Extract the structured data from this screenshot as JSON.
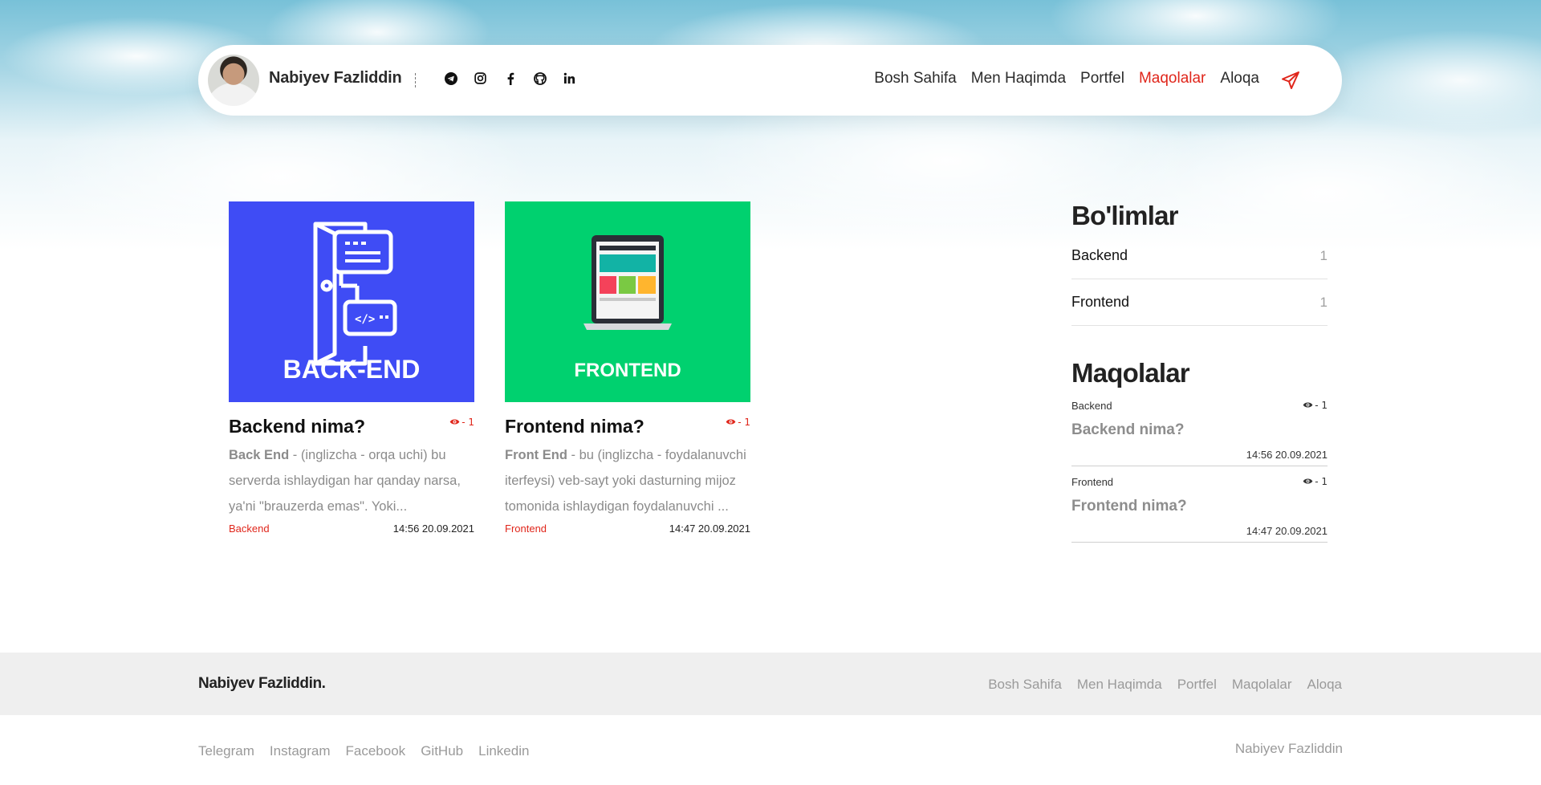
{
  "header": {
    "name": "Nabiyev Fazliddin",
    "socials": [
      {
        "icon": "telegram-icon",
        "glyph": "✈"
      },
      {
        "icon": "instagram-icon",
        "glyph": "◎"
      },
      {
        "icon": "facebook-icon",
        "glyph": "f"
      },
      {
        "icon": "github-icon",
        "glyph": "◉"
      },
      {
        "icon": "linkedin-icon",
        "glyph": "in"
      }
    ],
    "nav": [
      "Bosh Sahifa",
      "Men Haqimda",
      "Portfel",
      "Maqolalar",
      "Aloqa"
    ],
    "active_nav": "Maqolalar",
    "send_icon": "send-icon",
    "accent_color": "#e0261b"
  },
  "articles": [
    {
      "image": {
        "label": "BACK-END",
        "bg": "#3f4cf5",
        "icon": "backend-door-icon"
      },
      "title": "Backend nima?",
      "views": "- 1",
      "lead": "Back End",
      "excerpt": " - (inglizcha - orqa uchi) bu serverda ishlaydigan har qanday narsa, ya'ni \"brauzerda emas\". Yoki...",
      "category": "Backend",
      "date": "14:56 20.09.2021"
    },
    {
      "image": {
        "label": "FRONTEND",
        "bg": "#00d16f",
        "icon": "laptop-icon"
      },
      "title": "Frontend nima?",
      "views": "- 1",
      "lead": "Front End",
      "excerpt": " - bu (inglizcha - foydalanuvchi iterfeysi) veb-sayt yoki dasturning mijoz tomonida ishlaydigan foydalanuvchi ...",
      "category": "Frontend",
      "date": "14:47 20.09.2021"
    }
  ],
  "sidebar": {
    "categories_title": "Bo'limlar",
    "categories": [
      {
        "name": "Backend",
        "count": "1"
      },
      {
        "name": "Frontend",
        "count": "1"
      }
    ],
    "articles_title": "Maqolalar",
    "articles": [
      {
        "category": "Backend",
        "views": "- 1",
        "title": "Backend nima?",
        "date": "14:56 20.09.2021"
      },
      {
        "category": "Frontend",
        "views": "- 1",
        "title": "Frontend nima?",
        "date": "14:47 20.09.2021"
      }
    ]
  },
  "footer": {
    "brand": "Nabiyev Fazliddin.",
    "nav": [
      "Bosh Sahifa",
      "Men Haqimda",
      "Portfel",
      "Maqolalar",
      "Aloqa"
    ],
    "socials": [
      "Telegram",
      "Instagram",
      "Facebook",
      "GitHub",
      "Linkedin"
    ],
    "copyright": "Nabiyev Fazliddin"
  }
}
